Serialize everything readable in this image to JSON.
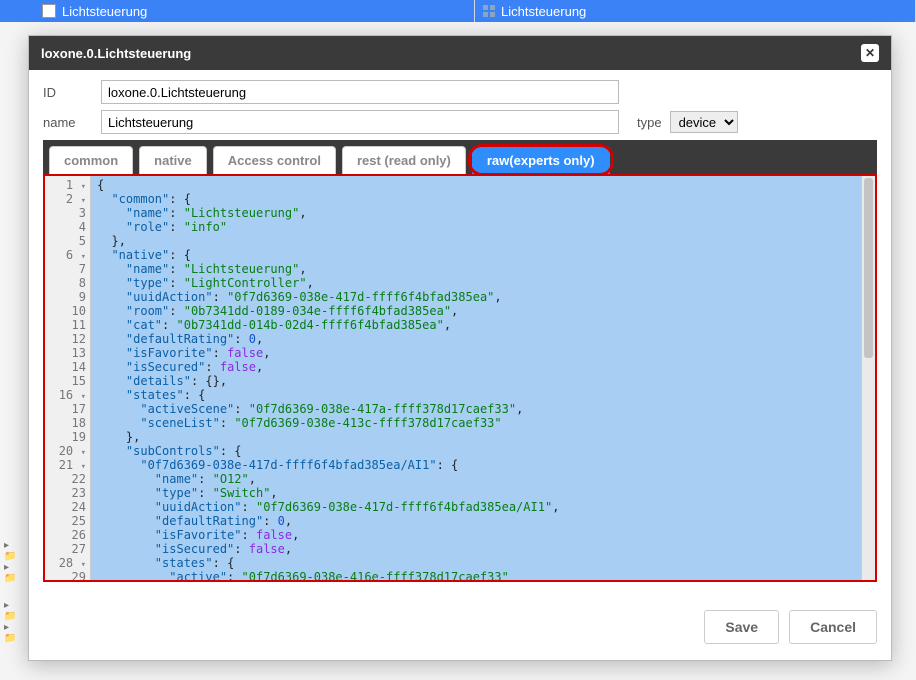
{
  "bg": {
    "left_label": "Lichtsteuerung",
    "right_label": "Lichtsteuerung"
  },
  "modal": {
    "title": "loxone.0.Lichtsteuerung",
    "fields": {
      "id_label": "ID",
      "id_value": "loxone.0.Lichtsteuerung",
      "name_label": "name",
      "name_value": "Lichtsteuerung",
      "type_label": "type",
      "type_value": "device"
    },
    "tabs": {
      "common": "common",
      "native": "native",
      "access": "Access control",
      "rest": "rest (read only)",
      "raw": "raw(experts only)"
    },
    "buttons": {
      "save": "Save",
      "cancel": "Cancel"
    }
  },
  "editor": {
    "lines": [
      "{",
      "  \"common\": {",
      "    \"name\": \"Lichtsteuerung\",",
      "    \"role\": \"info\"",
      "  },",
      "  \"native\": {",
      "    \"name\": \"Lichtsteuerung\",",
      "    \"type\": \"LightController\",",
      "    \"uuidAction\": \"0f7d6369-038e-417d-ffff6f4bfad385ea\",",
      "    \"room\": \"0b7341dd-0189-034e-ffff6f4bfad385ea\",",
      "    \"cat\": \"0b7341dd-014b-02d4-ffff6f4bfad385ea\",",
      "    \"defaultRating\": 0,",
      "    \"isFavorite\": false,",
      "    \"isSecured\": false,",
      "    \"details\": {},",
      "    \"states\": {",
      "      \"activeScene\": \"0f7d6369-038e-417a-ffff378d17caef33\",",
      "      \"sceneList\": \"0f7d6369-038e-413c-ffff378d17caef33\"",
      "    },",
      "    \"subControls\": {",
      "      \"0f7d6369-038e-417d-ffff6f4bfad385ea/AI1\": {",
      "        \"name\": \"O12\",",
      "        \"type\": \"Switch\",",
      "        \"uuidAction\": \"0f7d6369-038e-417d-ffff6f4bfad385ea/AI1\",",
      "        \"defaultRating\": 0,",
      "        \"isFavorite\": false,",
      "        \"isSecured\": false,",
      "        \"states\": {",
      "          \"active\": \"0f7d6369-038e-416e-ffff378d17caef33\""
    ],
    "fold_lines": [
      1,
      2,
      6,
      16,
      20,
      21,
      28
    ]
  }
}
